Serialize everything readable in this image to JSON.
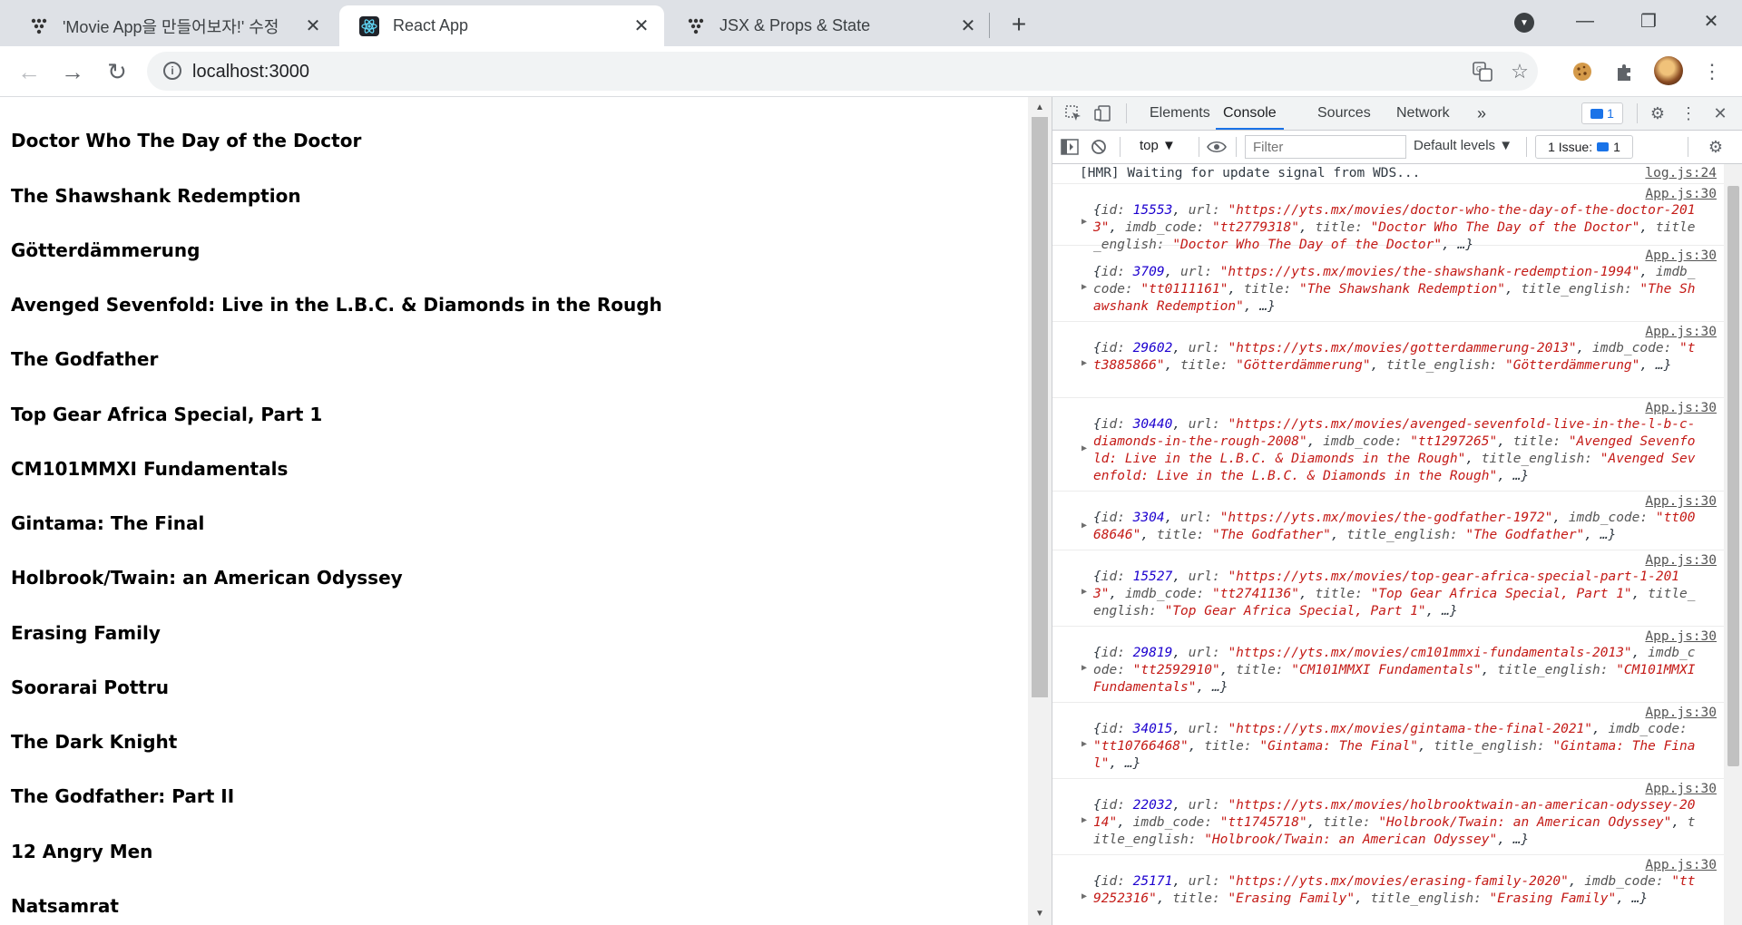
{
  "browser": {
    "tabs": [
      {
        "title": "'Movie App을 만들어보자!' 수정",
        "active": false,
        "icon": "glitch-dots-icon"
      },
      {
        "title": "React App",
        "active": true,
        "icon": "react-logo-icon"
      },
      {
        "title": "JSX & Props & State",
        "active": false,
        "icon": "glitch-dots-icon"
      }
    ],
    "address": "localhost:3000"
  },
  "movies": [
    "Doctor Who The Day of the Doctor",
    "The Shawshank Redemption",
    "Götterdämmerung",
    "Avenged Sevenfold: Live in the L.B.C. & Diamonds in the Rough",
    "The Godfather",
    "Top Gear Africa Special, Part 1",
    "CM101MMXI Fundamentals",
    "Gintama: The Final",
    "Holbrook/Twain: an American Odyssey",
    "Erasing Family",
    "Soorarai Pottru",
    "The Dark Knight",
    "The Godfather: Part II",
    "12 Angry Men",
    "Natsamrat"
  ],
  "devtools": {
    "tabs": [
      "Elements",
      "Console",
      "Sources",
      "Network"
    ],
    "active_tab": "Console",
    "more": "»",
    "message_badge": "1",
    "context": "top",
    "filter_placeholder": "Filter",
    "levels": "Default levels",
    "issues_label": "1 Issue:",
    "issues_count": "1",
    "console": [
      {
        "src": "log.js:24",
        "text": "[HMR] Waiting for update signal from WDS..."
      },
      {
        "src": "App.js:30",
        "id": "15553",
        "url": "\"https://yts.mx/movies/doctor-who-the-day-of-the-doctor-2013\"",
        "imdb": "\"tt2779318\"",
        "title": "\"Doctor Who The Day of the Doctor\"",
        "title_english": "\"Doctor Who The Day of the Doctor\""
      },
      {
        "src": "App.js:30",
        "id": "3709",
        "url": "\"https://yts.mx/movies/the-shawshank-redemption-1994\"",
        "imdb": "\"tt0111161\"",
        "title": "\"The Shawshank Redemption\"",
        "title_english": "\"The Shawshank Redemption\""
      },
      {
        "src": "App.js:30",
        "id": "29602",
        "url": "\"https://yts.mx/movies/gotterdammerung-2013\"",
        "imdb": "\"tt3885866\"",
        "title": "\"Götterdämmerung\"",
        "title_english": "\"Götterdämmerung\""
      },
      {
        "src": "App.js:30",
        "id": "30440",
        "url": "\"https://yts.mx/movies/avenged-sevenfold-live-in-the-l-b-c-diamonds-in-the-rough-2008\"",
        "imdb": "\"tt1297265\"",
        "title": "\"Avenged Sevenfold: Live in the L.B.C. & Diamonds in the Rough\"",
        "title_english": "\"Avenged Sevenfold: Live in the L.B.C. & Diamonds in the Rough\""
      },
      {
        "src": "App.js:30",
        "id": "3304",
        "url": "\"https://yts.mx/movies/the-godfather-1972\"",
        "imdb": "\"tt0068646\"",
        "title": "\"The Godfather\"",
        "title_english": "\"The Godfather\""
      },
      {
        "src": "App.js:30",
        "id": "15527",
        "url": "\"https://yts.mx/movies/top-gear-africa-special-part-1-2013\"",
        "imdb": "\"tt2741136\"",
        "title": "\"Top Gear Africa Special, Part 1\"",
        "title_english": "\"Top Gear Africa Special, Part 1\""
      },
      {
        "src": "App.js:30",
        "id": "29819",
        "url": "\"https://yts.mx/movies/cm101mmxi-fundamentals-2013\"",
        "imdb": "\"tt2592910\"",
        "title": "\"CM101MMXI Fundamentals\"",
        "title_english": "\"CM101MMXI Fundamentals\""
      },
      {
        "src": "App.js:30",
        "id": "34015",
        "url": "\"https://yts.mx/movies/gintama-the-final-2021\"",
        "imdb": "\"tt10766468\"",
        "title": "\"Gintama: The Final\"",
        "title_english": "\"Gintama: The Final\""
      },
      {
        "src": "App.js:30",
        "id": "22032",
        "url": "\"https://yts.mx/movies/holbrooktwain-an-american-odyssey-2014\"",
        "imdb": "\"tt1745718\"",
        "title": "\"Holbrook/Twain: an American Odyssey\"",
        "title_english": "\"Holbrook/Twain: an American Odyssey\""
      },
      {
        "src": "App.js:30",
        "id": "25171",
        "url": "\"https://yts.mx/movies/erasing-family-2020\"",
        "imdb": "\"tt9252316\"",
        "title": "\"Erasing Family\"",
        "title_english": "\"Erasing Family\""
      }
    ]
  }
}
